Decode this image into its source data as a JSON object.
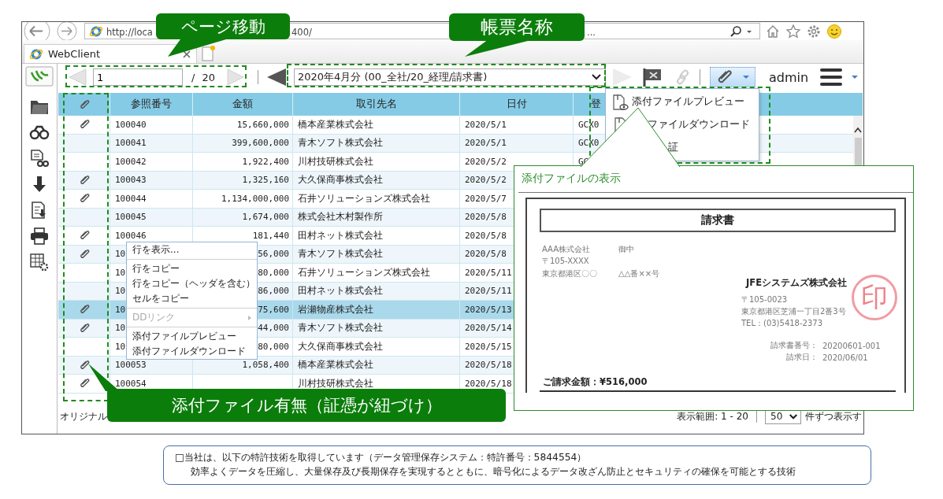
{
  "browser": {
    "address_parts": [
      "http://loca",
      "400/",
      "..."
    ],
    "tab": {
      "title": "WebClient"
    }
  },
  "toolbar": {
    "page_input": {
      "value": "1"
    },
    "page_separator": "/",
    "page_total": "20",
    "report_select": {
      "value": "2020年4月分 (00_全社/20_経理/請求書)"
    },
    "attachment_button": {
      "active": true
    },
    "user": "admin"
  },
  "table": {
    "columns": [
      {
        "kind": "attachment"
      },
      {
        "kind": "text",
        "label": "参照番号"
      },
      {
        "kind": "text",
        "label": "金額"
      },
      {
        "kind": "text",
        "label": "取引先名"
      },
      {
        "kind": "text",
        "label": "日付"
      },
      {
        "kind": "text",
        "label": "登"
      }
    ],
    "rows": [
      {
        "attachment": true,
        "selected": false,
        "ref": "100040",
        "amount": "15,660,000",
        "partner": "橋本産業株式会社",
        "date": "2020/5/1",
        "column_6": "GCX0"
      },
      {
        "attachment": false,
        "selected": false,
        "ref": "100041",
        "amount": "399,600,000",
        "partner": "青木ソフト株式会社",
        "date": "2020/5/1",
        "column_6": "GCX0"
      },
      {
        "attachment": false,
        "selected": false,
        "ref": "100042",
        "amount": "1,922,400",
        "partner": "川村技研株式会社",
        "date": "2020/5/2",
        "column_6": "GC"
      },
      {
        "attachment": true,
        "selected": false,
        "ref": "100043",
        "amount": "1,325,160",
        "partner": "大久保商事株式会社",
        "date": "2020/5/2"
      },
      {
        "attachment": true,
        "selected": false,
        "ref": "100044",
        "amount": "1,134,000,000",
        "partner": "石井ソリューションズ株式会社",
        "date": "2020/5/7"
      },
      {
        "attachment": false,
        "selected": false,
        "ref": "100045",
        "amount": "1,674,000",
        "partner": "株式会社木村製作所",
        "date": "2020/5/8"
      },
      {
        "attachment": true,
        "selected": false,
        "ref": "100046",
        "amount": "181,440",
        "partner": "田村ネット株式会社",
        "date": "2020/5/8"
      },
      {
        "attachment": true,
        "selected": false,
        "ref": "10",
        "amount": "56,000",
        "partner": "青木ソフト株式会社",
        "date": "2020/5/8"
      },
      {
        "attachment": false,
        "selected": false,
        "ref": "10",
        "amount": "80,000",
        "partner": "石井ソリューションズ株式会社",
        "date": "2020/5/11"
      },
      {
        "attachment": false,
        "selected": false,
        "ref": "10",
        "amount": "86,000",
        "partner": "田村ネット株式会社",
        "date": "2020/5/11"
      },
      {
        "attachment": true,
        "selected": true,
        "ref": "10",
        "amount": "75,600",
        "partner": "岩瀬物産株式会社",
        "date": "2020/5/13"
      },
      {
        "attachment": true,
        "selected": false,
        "ref": "10",
        "amount": "44,000",
        "partner": "青木ソフト株式会社",
        "date": "2020/5/14"
      },
      {
        "attachment": false,
        "selected": false,
        "ref": "10",
        "amount": "80,000",
        "partner": "大久保商事株式会社",
        "date": "2020/5/15"
      },
      {
        "attachment": true,
        "selected": false,
        "ref": "100053",
        "amount": "1,058,400",
        "partner": "橋本産業株式会社",
        "date": "2020/5/18"
      },
      {
        "attachment": true,
        "selected": false,
        "ref": "100054",
        "partner": "川村技研株式会社",
        "date": "2020/5/18"
      }
    ]
  },
  "footer": {
    "label": "オリジナル",
    "range": "表示範囲: 1 - 20",
    "page_size": "50",
    "page_size_suffix": "件ずつ表示す"
  },
  "context_menu": {
    "items": [
      {
        "kind": "item",
        "label": "行を表示...",
        "disabled": false,
        "submenu": false
      },
      {
        "kind": "separator"
      },
      {
        "kind": "item",
        "label": "行をコピー",
        "disabled": false,
        "submenu": false
      },
      {
        "kind": "item",
        "label": "行をコピー（ヘッダを含む）",
        "disabled": false,
        "submenu": false
      },
      {
        "kind": "item",
        "label": "セルをコピー",
        "disabled": false,
        "submenu": false
      },
      {
        "kind": "separator"
      },
      {
        "kind": "item",
        "label": "DDリンク",
        "disabled": true,
        "submenu": true
      },
      {
        "kind": "separator"
      },
      {
        "kind": "item",
        "label": "添付ファイルプレビュー",
        "disabled": false,
        "submenu": false
      },
      {
        "kind": "item",
        "label": "添付ファイルダウンロード",
        "disabled": false,
        "submenu": false
      }
    ]
  },
  "attachment_menu": {
    "items": [
      {
        "label": "添付ファイルプレビュー"
      },
      {
        "label": "ファイルダウンロード"
      },
      {
        "label": "証"
      }
    ]
  },
  "preview_panel": {
    "title": "添付ファイルの表示",
    "document": {
      "title": "請求書",
      "recipient": "AAA株式会社",
      "honorific": "御中",
      "recipient_postcode": "〒105-XXXX",
      "recipient_address": "東京都港区〇〇",
      "recipient_address_2": "△△番××号",
      "issuer": "JFEシステムズ株式会社",
      "issuer_postcode": "〒105-0023",
      "issuer_address": "東京都港区芝浦一丁目2番3号",
      "issuer_tel": "TEL：(03)5418-2373",
      "fields": [
        {
          "label": "請求書番号：",
          "value": "20200601-001"
        },
        {
          "label": "請求日：",
          "value": "2020/06/01"
        }
      ],
      "total": "ご請求金額：¥516,000",
      "stamp": "印"
    }
  },
  "callouts": [
    {
      "text": "ページ移動"
    },
    {
      "text": "帳票名称"
    },
    {
      "text": "添付ファイル有無（証憑が紐づけ）"
    }
  ],
  "note": {
    "lines": [
      "□当社は、以下の特許技術を取得しています（データ管理保存システム：特許番号：5844554）",
      "効率よくデータを圧縮し、大量保存及び長期保存を実現するとともに、暗号化によるデータ改ざん防止とセキュリティの確保を可能とする技術"
    ]
  }
}
